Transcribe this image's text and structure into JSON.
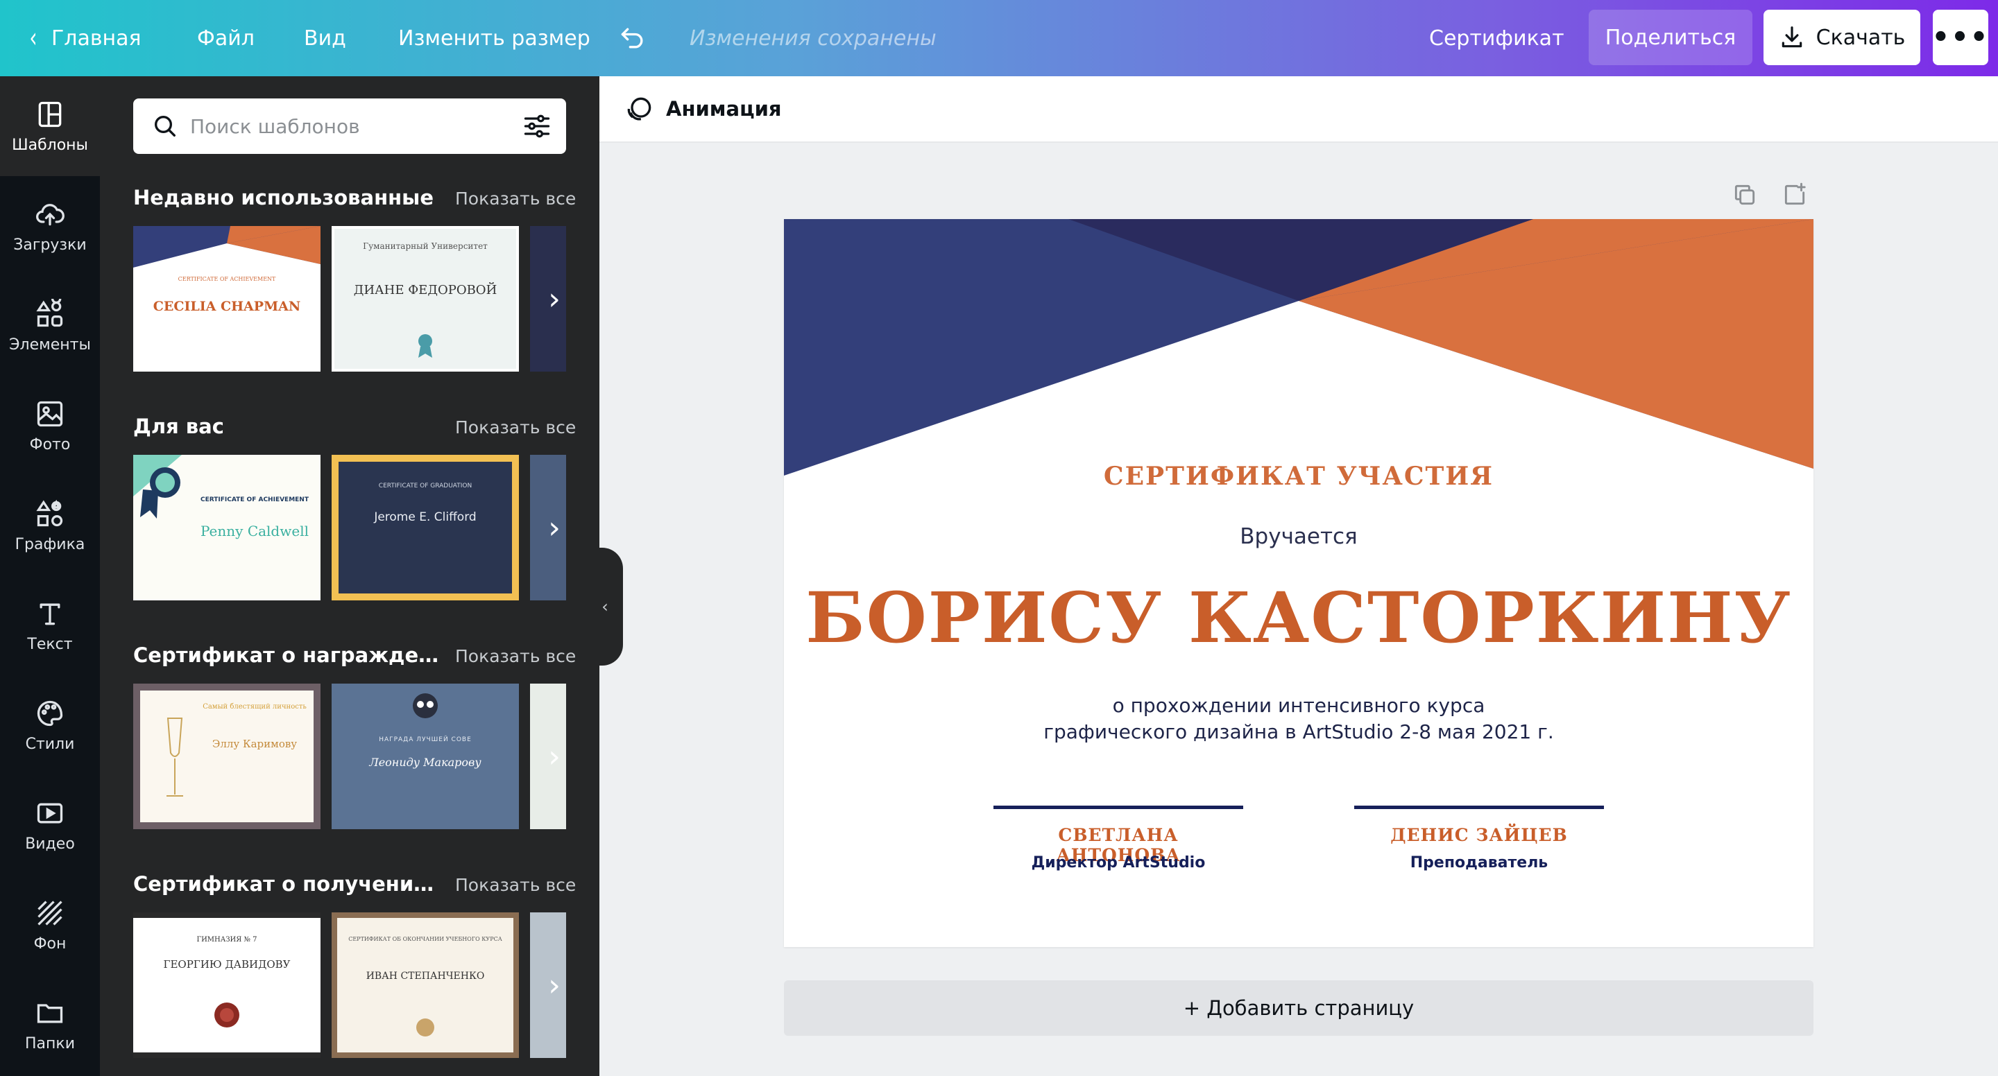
{
  "topbar": {
    "home": "Главная",
    "file": "Файл",
    "view": "Вид",
    "resize": "Изменить размер",
    "saved_status": "Изменения сохранены",
    "doc_title": "Сертификат",
    "share": "Поделиться",
    "download": "Скачать",
    "more": "•••"
  },
  "rail": [
    {
      "label": "Шаблоны",
      "icon": "layout-icon",
      "active": true
    },
    {
      "label": "Загрузки",
      "icon": "upload-cloud-icon"
    },
    {
      "label": "Элементы",
      "icon": "shapes-icon"
    },
    {
      "label": "Фото",
      "icon": "photo-icon"
    },
    {
      "label": "Графика",
      "icon": "graphics-icon"
    },
    {
      "label": "Текст",
      "icon": "text-icon"
    },
    {
      "label": "Стили",
      "icon": "palette-icon"
    },
    {
      "label": "Видео",
      "icon": "video-icon"
    },
    {
      "label": "Фон",
      "icon": "pattern-icon"
    },
    {
      "label": "Папки",
      "icon": "folder-icon"
    }
  ],
  "panel": {
    "search_placeholder": "Поиск шаблонов",
    "sections": [
      {
        "title": "Недавно использованные",
        "show_all": "Показать все",
        "thumbs": [
          {
            "line1": "CERTIFICATE OF ACHIEVEMENT",
            "line2": "CECILIA CHAPMAN"
          },
          {
            "line1": "Гуманитарный Университет",
            "line2": "ДИАНЕ ФЕДОРОВОЙ"
          }
        ]
      },
      {
        "title": "Для вас",
        "show_all": "Показать все",
        "thumbs": [
          {
            "line1": "CERTIFICATE OF ACHIEVEMENT",
            "line2": "Penny Caldwell"
          },
          {
            "line1": "CERTIFICATE OF GRADUATION",
            "line2": "Jerome E. Clifford"
          }
        ]
      },
      {
        "title": "Сертификат о награждении",
        "show_all": "Показать все",
        "thumbs": [
          {
            "line1": "Самый блестящий личность",
            "line2": "Эллу Каримову"
          },
          {
            "line1": "НАГРАДА ЛУЧШЕЙ СОВЕ",
            "line2": "Леониду Макарову"
          }
        ]
      },
      {
        "title": "Сертификат о получении ди...",
        "show_all": "Показать все",
        "thumbs": [
          {
            "line1": "ГИМНАЗИЯ № 7",
            "line2": "ГЕОРГИЮ ДАВИДОВУ"
          },
          {
            "line1": "СЕРТИФИКАТ ОБ ОКОНЧАНИИ УЧЕБНОГО КУРСА",
            "line2": "ИВАН СТЕПАНЧЕНКО"
          }
        ]
      }
    ]
  },
  "editor": {
    "animation": "Анимация",
    "add_page": "+ Добавить страницу"
  },
  "certificate": {
    "kind": "СЕРТИФИКАТ УЧАСТИЯ",
    "given": "Вручается",
    "recipient": "БОРИСУ КАСТОРКИНУ",
    "desc_line1": "о прохождении интенсивного курса",
    "desc_line2": "графического дизайна в ArtStudio 2-8 мая 2021 г.",
    "signers": [
      {
        "name": "СВЕТЛАНА АНТОНОВА",
        "role": "Директор ArtStudio"
      },
      {
        "name": "ДЕНИС ЗАЙЦЕВ",
        "role": "Преподаватель"
      }
    ],
    "colors": {
      "navy": "#333f7a",
      "orange": "#d9713f",
      "dark": "#2a2b5e"
    }
  }
}
